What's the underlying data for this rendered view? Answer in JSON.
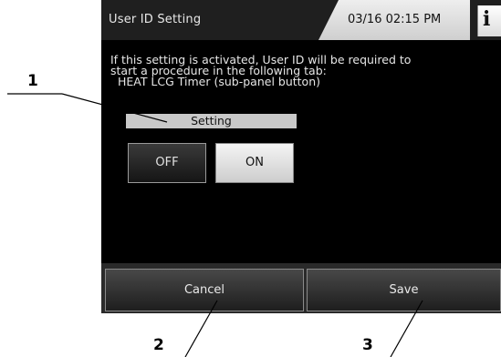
{
  "titlebar": {
    "title": "User ID Setting",
    "datetime": "03/16 02:15 PM",
    "info_label": "i"
  },
  "description": {
    "lines": [
      "If this setting is activated, User ID will be required to",
      "start a procedure in the following tab:",
      "  HEAT LCG Timer (sub-panel button)"
    ]
  },
  "setting": {
    "label": "Setting",
    "options": [
      "OFF",
      "ON"
    ],
    "selected": "ON"
  },
  "footer": {
    "cancel_label": "Cancel",
    "save_label": "Save"
  },
  "callouts": {
    "one": "1",
    "two": "2",
    "three": "3"
  },
  "colors": {
    "screen_bg": "#000000",
    "titlebar_bg": "#1f1f1f",
    "selected_button": "#e0e0e0",
    "unselected_button": "#262626"
  }
}
